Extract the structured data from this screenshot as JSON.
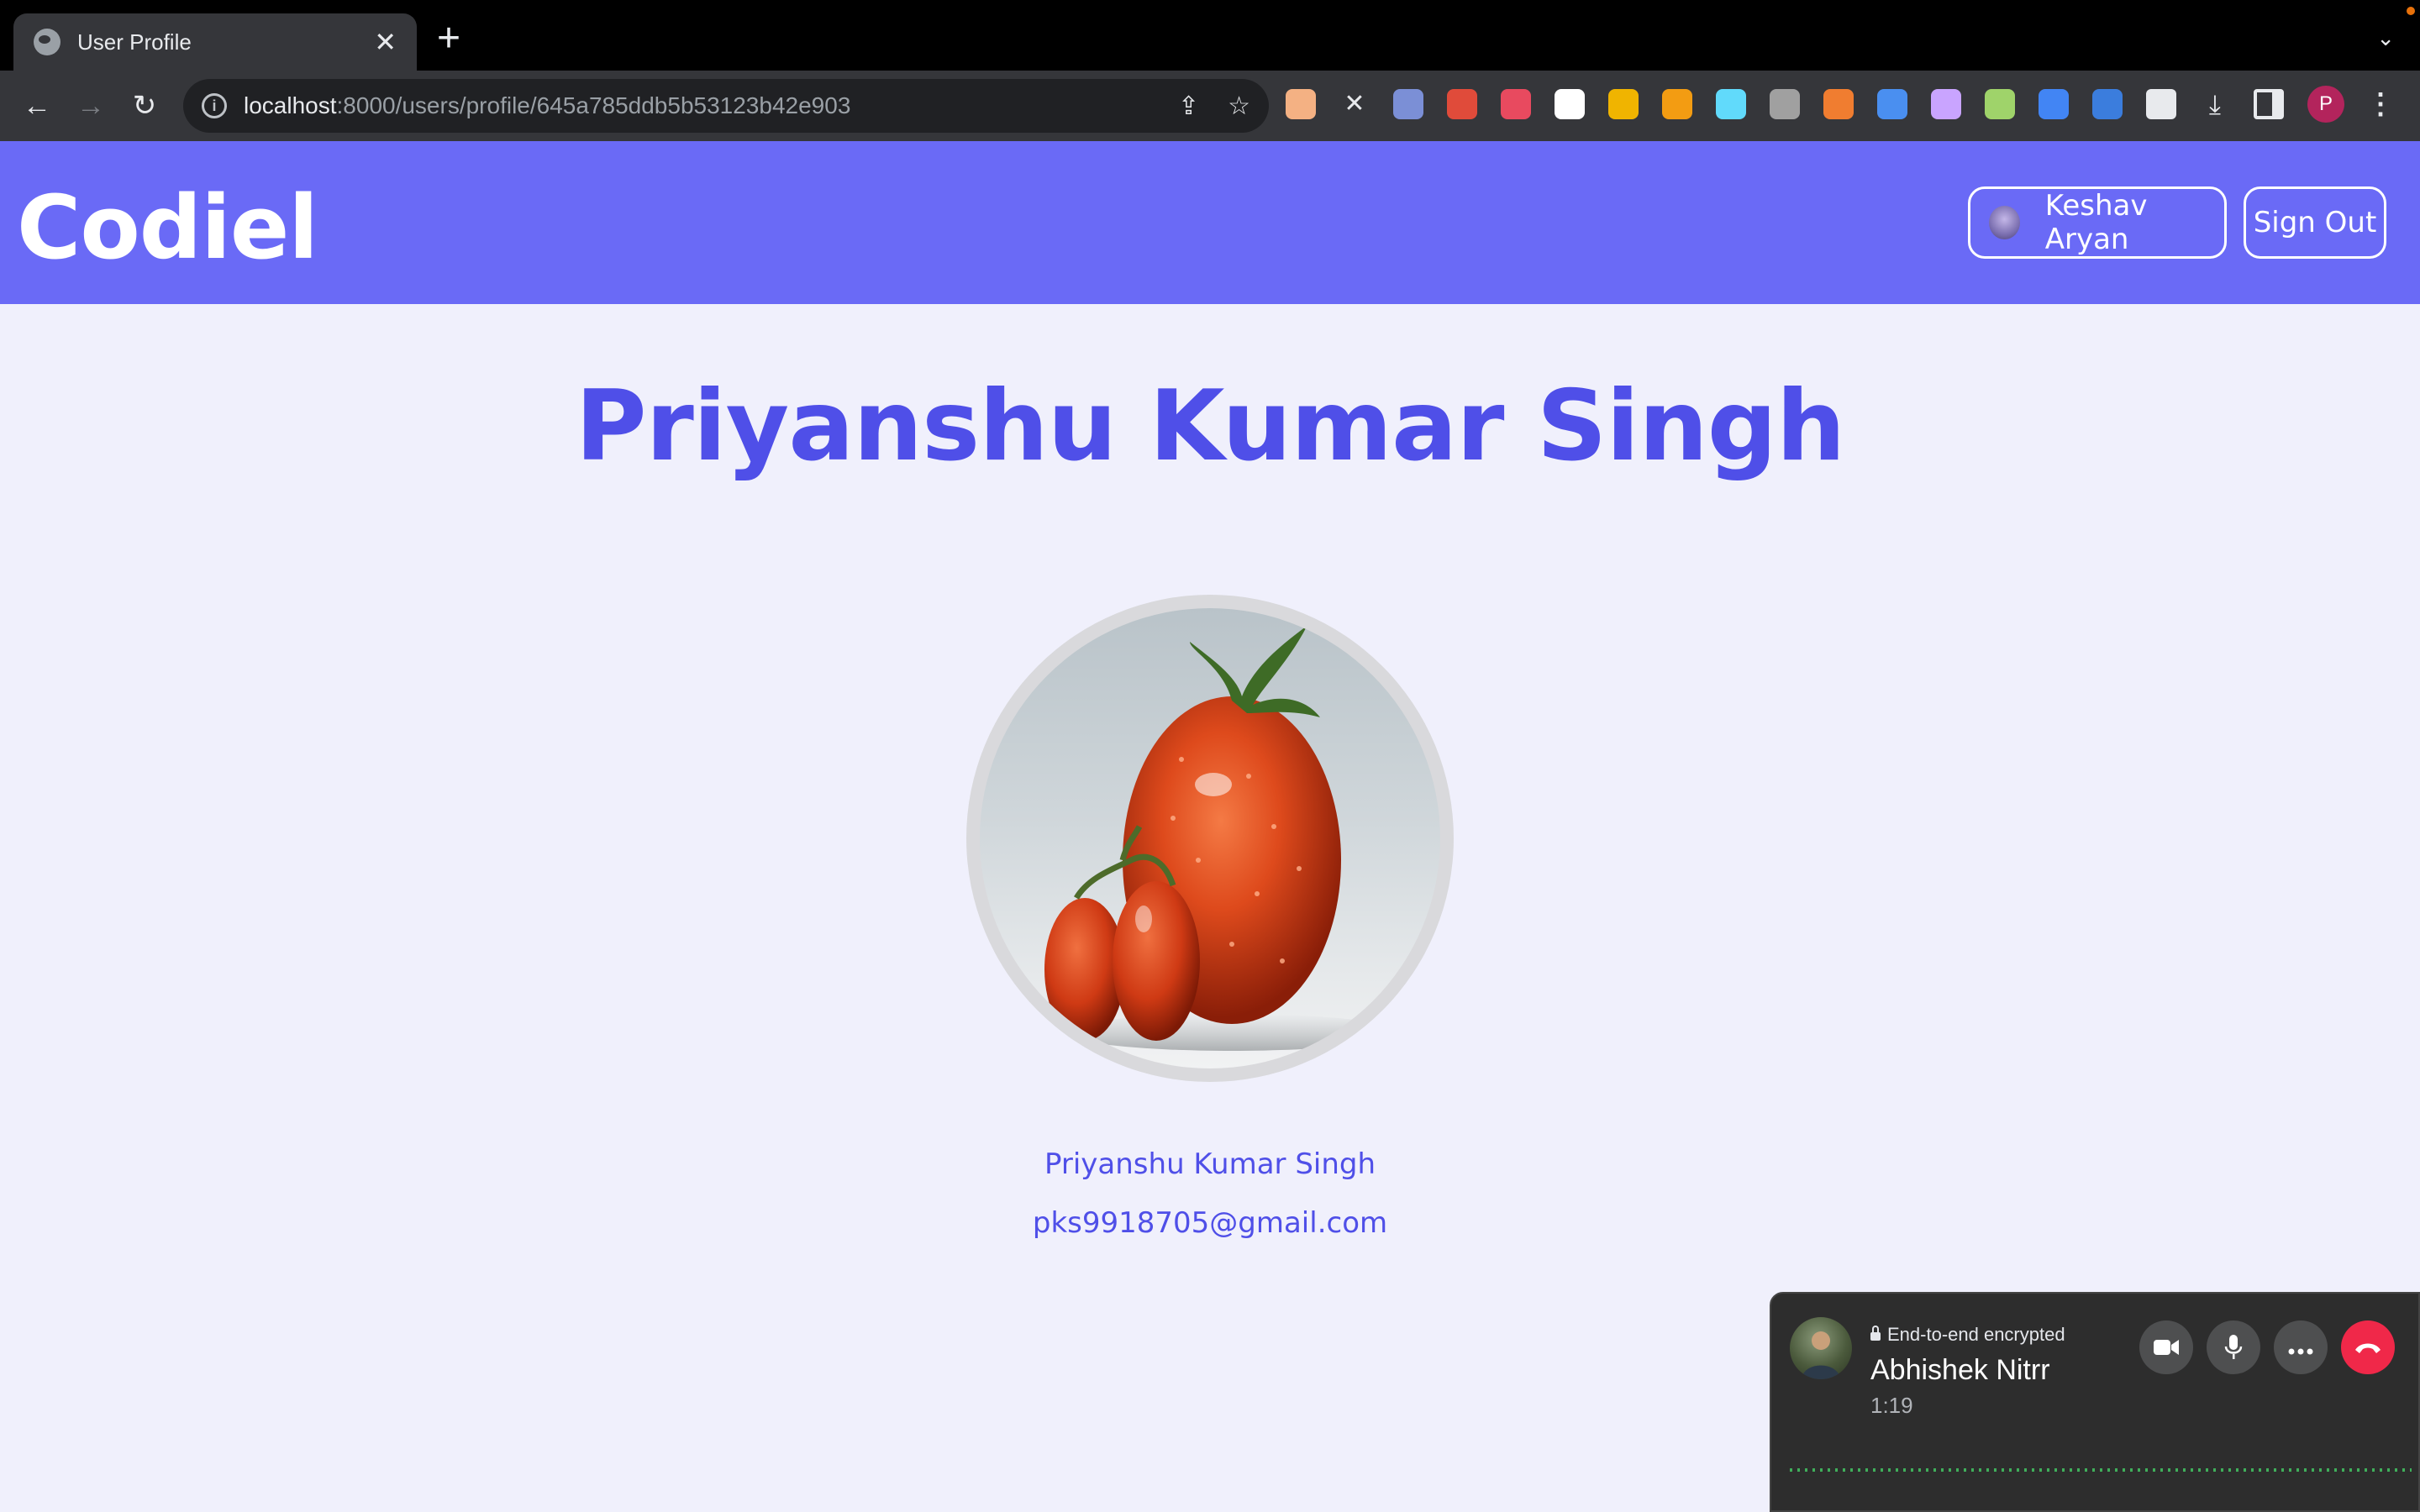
{
  "browser": {
    "tab_title": "User Profile",
    "url_host": "localhost",
    "url_path": ":8000/users/profile/645a785ddb5b53123b42e903",
    "profile_initial": "P",
    "extensions": [
      {
        "name": "extension-icon-1",
        "color": "#f4b183"
      },
      {
        "name": "mute-icon",
        "color": "#35363a"
      },
      {
        "name": "shield-extension-icon",
        "color": "#7b8fd6"
      },
      {
        "name": "extension-icon-3",
        "color": "#e04b3a"
      },
      {
        "name": "extension-icon-4",
        "color": "#e84a5f"
      },
      {
        "name": "omega-extension-icon",
        "color": "#ffffff"
      },
      {
        "name": "lh-extension-icon",
        "color": "#f0b400"
      },
      {
        "name": "extension-icon-7",
        "color": "#f39c12"
      },
      {
        "name": "react-devtools-icon",
        "color": "#61dafb"
      },
      {
        "name": "extension-icon-9",
        "color": "#a0a0a0"
      },
      {
        "name": "extension-icon-10",
        "color": "#f07d30"
      },
      {
        "name": "screenshot-extension-icon",
        "color": "#4a8ff0"
      },
      {
        "name": "extension-icon-12",
        "color": "#c9a4ff"
      },
      {
        "name": "extension-icon-13",
        "color": "#9fd36a"
      },
      {
        "name": "extension-icon-14",
        "color": "#4285f4"
      },
      {
        "name": "extension-icon-15",
        "color": "#3b7ddd"
      }
    ]
  },
  "header": {
    "logo": "Codiel",
    "user_name": "Keshav Aryan",
    "signout_label": "Sign Out",
    "bg_color": "#6a6af6"
  },
  "profile": {
    "title": "Priyanshu Kumar Singh",
    "name": "Priyanshu Kumar Singh",
    "email": "pks9918705@gmail.com",
    "accent_color": "#4f4fe8"
  },
  "call": {
    "encryption_label": "End-to-end encrypted",
    "caller_name": "Abhishek Nitrr",
    "duration": "1:19",
    "end_color": "#f02849"
  }
}
